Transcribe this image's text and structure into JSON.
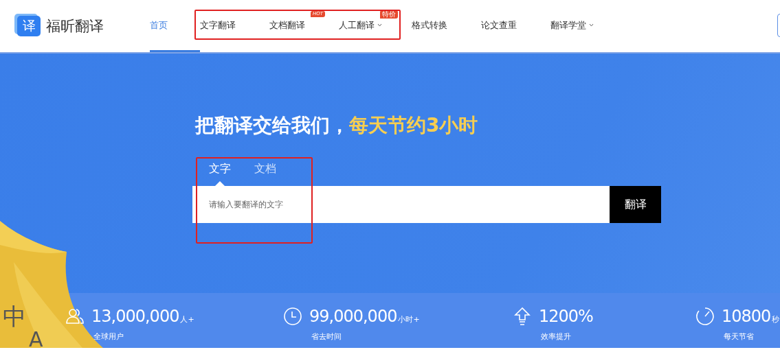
{
  "logo": {
    "mark": "译",
    "name": "福昕翻译"
  },
  "nav": [
    {
      "label": "首页",
      "selected": true,
      "dropdown": false
    },
    {
      "label": "文字翻译",
      "selected": false,
      "dropdown": false
    },
    {
      "label": "文档翻译",
      "selected": false,
      "dropdown": false,
      "badge": "HOT"
    },
    {
      "label": "人工翻译",
      "selected": false,
      "dropdown": true,
      "badge": "特价"
    },
    {
      "label": "格式转换",
      "selected": false,
      "dropdown": false
    },
    {
      "label": "论文查重",
      "selected": false,
      "dropdown": false
    },
    {
      "label": "翻译学堂",
      "selected": false,
      "dropdown": true
    }
  ],
  "hero": {
    "title": "把翻译交给我们，",
    "title_highlight": "每天节约3小时",
    "tabs": [
      {
        "label": "文字",
        "selected": true
      },
      {
        "label": "文档",
        "selected": false
      }
    ],
    "search": {
      "placeholder": "请输入要翻译的文字",
      "button": "翻译"
    },
    "decoration": {
      "letters": [
        "中",
        "A"
      ]
    }
  },
  "stats": [
    {
      "kind": "users",
      "value": "13,000,000",
      "unit": "人+",
      "label": "全球用户"
    },
    {
      "kind": "clock",
      "value": "99,000,000",
      "unit": "小时+",
      "label": "省去时间"
    },
    {
      "kind": "arrow",
      "value": "1200%",
      "label": "效率提升"
    },
    {
      "kind": "timer",
      "value": "10800",
      "unit": "秒",
      "label": "每天节省"
    }
  ]
}
